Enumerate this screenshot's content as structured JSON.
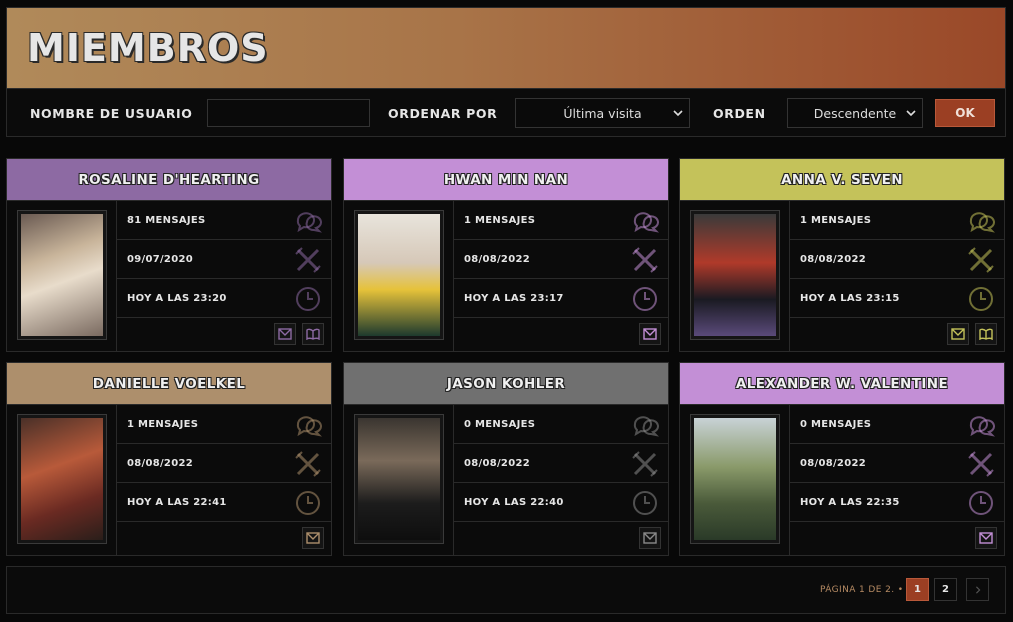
{
  "page": {
    "title": "MIEMBROS"
  },
  "filter": {
    "username_label": "NOMBRE DE USUARIO",
    "username_value": "",
    "sort_label": "ORDENAR POR",
    "sort_value": "Última visita",
    "order_label": "ORDEN",
    "order_value": "Descendente",
    "ok_label": "OK"
  },
  "members": [
    {
      "name": "ROSALINE D'HEARTING",
      "color": "#8d6aa3",
      "icon_color": "#8d6aa3",
      "messages": "81 MENSAJES",
      "joined": "09/07/2020",
      "last_visit": "HOY A LAS 23:20",
      "actions": [
        "mail-icon",
        "book-icon"
      ]
    },
    {
      "name": "HWAN MIN NAN",
      "color": "#c38fd6",
      "icon_color": "#c38fd6",
      "messages": "1 MENSAJES",
      "joined": "08/08/2022",
      "last_visit": "HOY A LAS 23:17",
      "actions": [
        "mail-icon"
      ]
    },
    {
      "name": "ANNA V. SEVEN",
      "color": "#c4c25a",
      "icon_color": "#c4c25a",
      "messages": "1 MENSAJES",
      "joined": "08/08/2022",
      "last_visit": "HOY A LAS 23:15",
      "actions": [
        "mail-icon",
        "book-icon"
      ]
    },
    {
      "name": "DANIELLE VOELKEL",
      "color": "#ad8f6c",
      "icon_color": "#ad8f6c",
      "messages": "1 MENSAJES",
      "joined": "08/08/2022",
      "last_visit": "HOY A LAS 22:41",
      "actions": [
        "mail-icon"
      ]
    },
    {
      "name": "JASON KOHLER",
      "color": "#707070",
      "icon_color": "#8a8a8a",
      "messages": "0 MENSAJES",
      "joined": "08/08/2022",
      "last_visit": "HOY A LAS 22:40",
      "actions": [
        "mail-icon"
      ]
    },
    {
      "name": "ALEXANDER W. VALENTINE",
      "color": "#c38fd6",
      "icon_color": "#c38fd6",
      "messages": "0 MENSAJES",
      "joined": "08/08/2022",
      "last_visit": "HOY A LAS 22:35",
      "actions": [
        "mail-icon"
      ]
    }
  ],
  "pagination": {
    "info": "PÁGINA 1 DE 2. •",
    "pages": [
      "1",
      "2"
    ],
    "current": "1",
    "next_icon": "chevron-right-icon"
  },
  "colors": {
    "accent": "#9b3f23",
    "panel": "#0b0b0b",
    "border": "#2a2a2a"
  }
}
